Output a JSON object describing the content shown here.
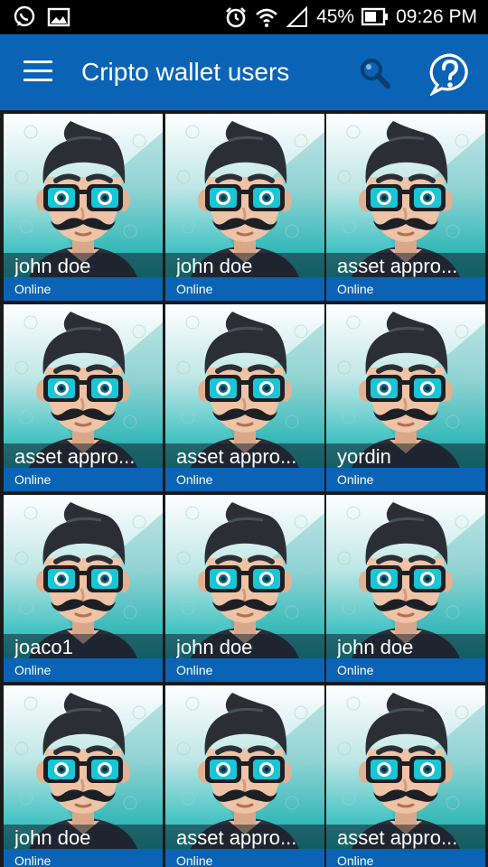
{
  "status_bar": {
    "battery": "45%",
    "time": "09:26 PM",
    "icons": [
      "whatsapp-icon",
      "gallery-icon",
      "alarm-icon",
      "wifi-icon",
      "signal-icon",
      "battery-icon"
    ]
  },
  "app_bar": {
    "title": "Cripto wallet users",
    "icons": [
      "menu-icon",
      "search-icon",
      "help-icon"
    ],
    "color": "#0b63b5"
  },
  "users": [
    {
      "name": "john doe",
      "status": "Online"
    },
    {
      "name": "john doe",
      "status": "Online"
    },
    {
      "name": "asset appro...",
      "status": "Online"
    },
    {
      "name": "asset appro...",
      "status": "Online"
    },
    {
      "name": "asset appro...",
      "status": "Online"
    },
    {
      "name": "yordin",
      "status": "Online"
    },
    {
      "name": "joaco1",
      "status": "Online"
    },
    {
      "name": "john doe",
      "status": "Online"
    },
    {
      "name": "john doe",
      "status": "Online"
    },
    {
      "name": "john doe",
      "status": "Online"
    },
    {
      "name": "asset appro...",
      "status": "Online"
    },
    {
      "name": "asset appro...",
      "status": "Online"
    }
  ]
}
